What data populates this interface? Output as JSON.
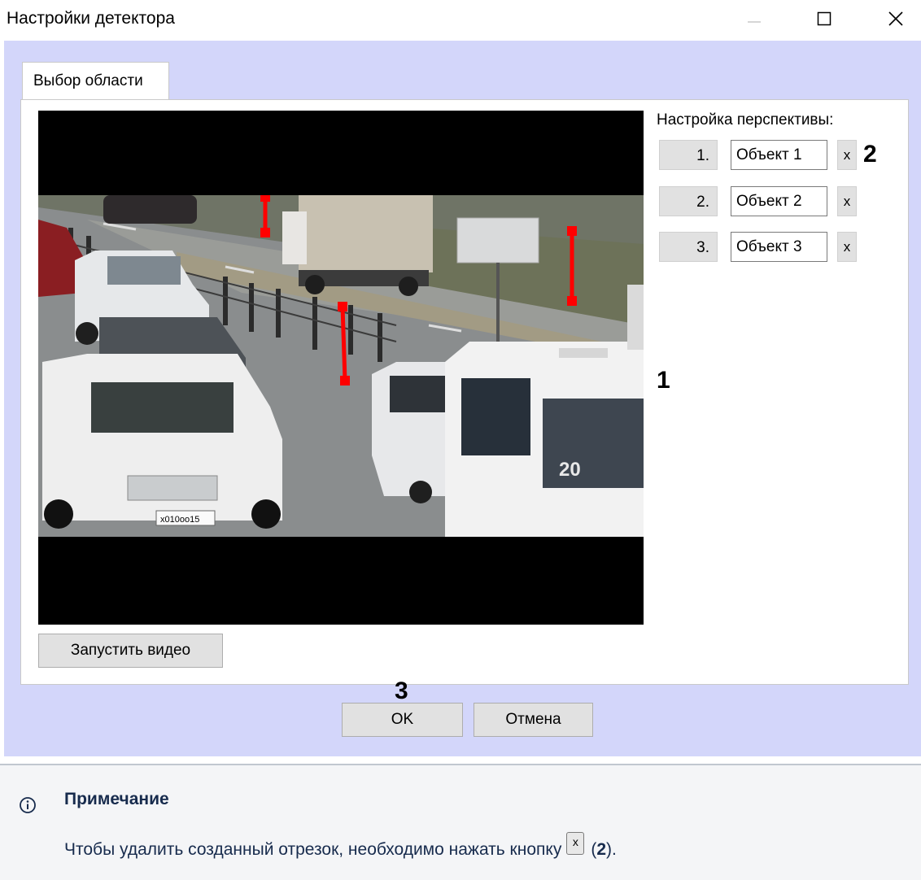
{
  "window": {
    "title": "Настройки детектора",
    "controls": {
      "minimize": "minimize-icon",
      "maximize": "maximize-icon",
      "close": "close-icon"
    },
    "client_bg": "#d3d6fa"
  },
  "tabs": [
    {
      "label": "Выбор области",
      "active": true
    }
  ],
  "video": {
    "start_button": "Запустить видео",
    "image": "camera-view-road-with-cars",
    "plate_text": "x010oo15",
    "route_number": "20"
  },
  "perspective": {
    "title": "Настройка перспективы:",
    "rows": [
      {
        "num": "1.",
        "name": "Объект 1",
        "delete": "x"
      },
      {
        "num": "2.",
        "name": "Объект 2",
        "delete": "x"
      },
      {
        "num": "3.",
        "name": "Объект 3",
        "delete": "x"
      }
    ]
  },
  "footer": {
    "ok": "OK",
    "cancel": "Отмена"
  },
  "callouts": {
    "c1": "1",
    "c2": "2",
    "c3": "3"
  },
  "note": {
    "icon": "info-icon",
    "title": "Примечание",
    "text_before": "Чтобы удалить созданный отрезок, необходимо нажать кнопку",
    "button_glyph": "x",
    "text_open": "(",
    "text_ref": "2",
    "text_after": ")."
  },
  "colors": {
    "segment": "#ff0000",
    "note_bg": "#f4f5f7",
    "note_text": "#172b4d"
  }
}
